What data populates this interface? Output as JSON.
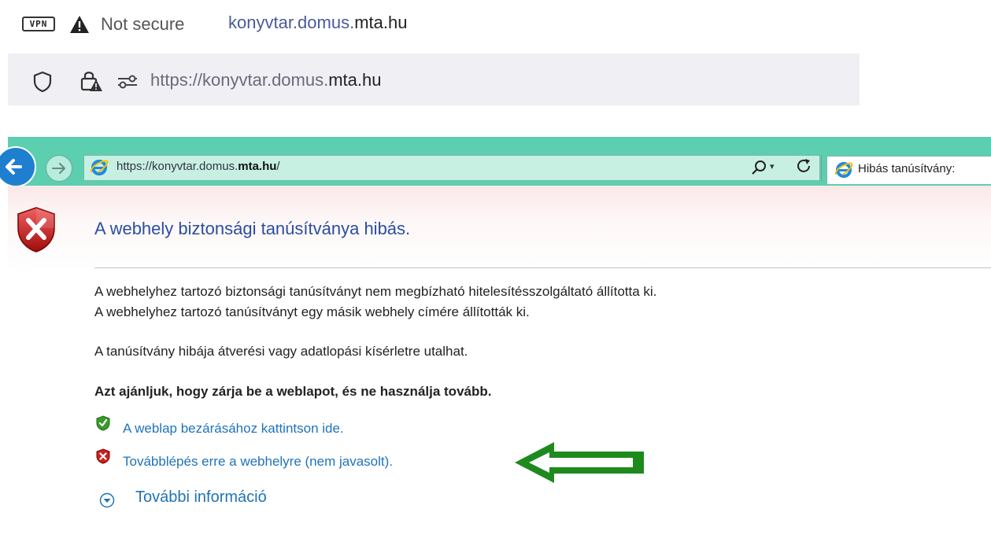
{
  "bar1": {
    "vpn_label": "VPN",
    "not_secure": "Not secure",
    "domain_prefix": "konyvtar.domus.",
    "domain_main": "mta.hu"
  },
  "bar2": {
    "url_prefix": "https://konyvtar.domus.",
    "url_main": "mta.hu"
  },
  "ie_toolbar": {
    "url_prefix": "https://konyvtar.domus.",
    "url_main": "mta.hu",
    "url_suffix": "/",
    "search_dropdown": "▾",
    "tab_title": "Hibás tanúsítvány:"
  },
  "content": {
    "heading": "A webhely biztonsági tanúsítványa hibás.",
    "para1": "A webhelyhez tartozó biztonsági tanúsítványt nem megbízható hitelesítésszolgáltató állította ki.",
    "para2": "A webhelyhez tartozó tanúsítványt egy másik webhely címére állították ki.",
    "para3": "A tanúsítvány hibája átverési vagy adatlopási kísérletre utalhat.",
    "bold": "Azt ajánljuk, hogy zárja be a weblapot, és ne használja tovább.",
    "link_close": "A weblap bezárásához kattintson ide.",
    "link_continue": "Továbblépés erre a webhelyre (nem javasolt).",
    "more_info": "További információ"
  },
  "colors": {
    "toolbar": "#5ccfb0",
    "link": "#1f73b8",
    "heading": "#2a4ea0",
    "arrow": "#1e8a1e"
  },
  "icons": [
    "warning-triangle-icon",
    "shield-outline-icon",
    "lock-warning-icon",
    "tune-icon",
    "ie-logo-icon",
    "search-icon",
    "refresh-icon",
    "error-shield-icon",
    "ok-shield-icon",
    "expand-circle-icon",
    "green-arrow-icon"
  ]
}
